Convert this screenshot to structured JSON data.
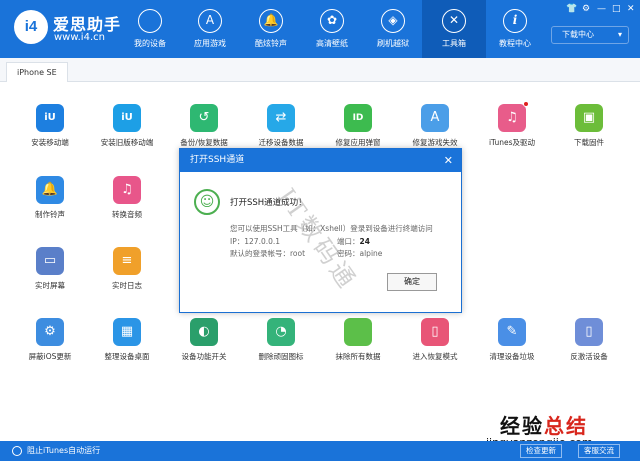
{
  "brand": {
    "logo_text": "i4",
    "name": "爱思助手",
    "url": "www.i4.cn"
  },
  "nav": [
    {
      "label": "我的设备",
      "icon": "apple-icon",
      "glyph": ""
    },
    {
      "label": "应用游戏",
      "icon": "app-store-icon",
      "glyph": "A"
    },
    {
      "label": "酷炫铃声",
      "icon": "bell-icon",
      "glyph": "🔔"
    },
    {
      "label": "高清壁纸",
      "icon": "flower-icon",
      "glyph": "✿"
    },
    {
      "label": "刷机越狱",
      "icon": "dropbox-icon",
      "glyph": "◈"
    },
    {
      "label": "工具箱",
      "icon": "tools-icon",
      "glyph": "✕"
    },
    {
      "label": "教程中心",
      "icon": "info-icon",
      "glyph": "i"
    }
  ],
  "window_controls": {
    "shirt": "👕",
    "settings": "⚙",
    "minimize": "—",
    "maximize": "□",
    "close": "✕"
  },
  "download_center": "下载中心",
  "device_tab": "iPhone SE",
  "tools": [
    {
      "label": "安装移动端",
      "icon": "i4-install-icon",
      "glyph": "iU",
      "color": "#1d7fe0"
    },
    {
      "label": "安装旧版移动端",
      "icon": "i4-legacy-install-icon",
      "glyph": "iU",
      "color": "#1d9fe6"
    },
    {
      "label": "备份/恢复数据",
      "icon": "backup-restore-icon",
      "glyph": "↺",
      "color": "#2eb872"
    },
    {
      "label": "迁移设备数据",
      "icon": "migrate-data-icon",
      "glyph": "⇄",
      "color": "#26a8e8"
    },
    {
      "label": "修复应用弹窗",
      "icon": "apple-id-repair-icon",
      "glyph": "ID",
      "color": "#3dbb4f"
    },
    {
      "label": "修复游戏失效",
      "icon": "game-repair-icon",
      "glyph": "A",
      "color": "#4b9ee8"
    },
    {
      "label": "iTunes及驱动",
      "icon": "itunes-icon",
      "glyph": "♫",
      "color": "#e85c8a"
    },
    {
      "label": "下载固件",
      "icon": "firmware-download-icon",
      "glyph": "▣",
      "color": "#6cbd3a"
    },
    {
      "label": "制作铃声",
      "icon": "ringtone-icon",
      "glyph": "🔔",
      "color": "#2f8ae4"
    },
    {
      "label": "转换音频",
      "icon": "audio-convert-icon",
      "glyph": "♫",
      "color": "#e8568a"
    },
    {
      "label": "实时屏幕",
      "icon": "screen-mirror-icon",
      "glyph": "▭",
      "color": "#5a7fc9"
    },
    {
      "label": "实时日志",
      "icon": "realtime-log-icon",
      "glyph": "≡",
      "color": "#f0a02a"
    },
    {
      "label": "屏蔽iOS更新",
      "icon": "block-update-icon",
      "glyph": "⚙",
      "color": "#3d8de0"
    },
    {
      "label": "整理设备桌面",
      "icon": "organize-desktop-icon",
      "glyph": "▦",
      "color": "#2b95e6"
    },
    {
      "label": "设备功能开关",
      "icon": "feature-toggle-icon",
      "glyph": "◐",
      "color": "#2a9f6b"
    },
    {
      "label": "删除顽固图标",
      "icon": "delete-icon-icon",
      "glyph": "◔",
      "color": "#34b37a"
    },
    {
      "label": "抹除所有数据",
      "icon": "erase-data-icon",
      "glyph": "",
      "color": "#5cbf49"
    },
    {
      "label": "进入恢复模式",
      "icon": "recovery-mode-icon",
      "glyph": "▯",
      "color": "#e85577"
    },
    {
      "label": "清理设备垃圾",
      "icon": "clean-junk-icon",
      "glyph": "✎",
      "color": "#4a8fe6"
    },
    {
      "label": "反激活设备",
      "icon": "deactivate-icon",
      "glyph": "▯",
      "color": "#6f8ed8"
    }
  ],
  "dialog": {
    "title": "打开SSH通道",
    "close": "✕",
    "message": "打开SSH通道成功！",
    "description": "您可以使用SSH工具（如：Xshell）登录到设备进行终端访问",
    "ip_label": "IP：",
    "ip": "127.0.0.1",
    "port_label": "端口：",
    "port": "24",
    "user_label": "默认的登录帐号：",
    "user": "root",
    "pass_label": "密码：",
    "pass": "alpine",
    "ok": "确定"
  },
  "watermark": {
    "diagonal": "IT数码通",
    "site_a": "经验",
    "site_b": "总结",
    "url": "jingyanzongjie.com"
  },
  "status": {
    "block_itunes": "阻止iTunes自动运行",
    "btn1": "检查更新",
    "btn2": "客服交流"
  },
  "colors": {
    "primary": "#1a73d9",
    "nav_active": "#0f5cb8",
    "success": "#4caf50"
  }
}
